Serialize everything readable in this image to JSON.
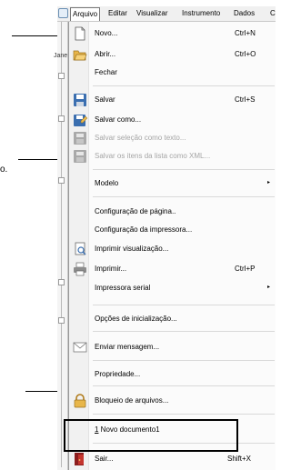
{
  "menubar": {
    "items": [
      "Arquivo",
      "Editar",
      "Visualizar",
      "Instrumento",
      "Dados",
      "C"
    ]
  },
  "background": {
    "tab_label": "Jane"
  },
  "outside_text": {
    "partial": "o."
  },
  "menu": {
    "novo": {
      "label": "Novo...",
      "shortcut": "Ctrl+N"
    },
    "abrir": {
      "label": "Abrir...",
      "shortcut": "Ctrl+O"
    },
    "fechar": {
      "label": "Fechar"
    },
    "salvar": {
      "label": "Salvar",
      "shortcut": "Ctrl+S"
    },
    "salvar_como": {
      "label": "Salvar como..."
    },
    "salvar_selecao": {
      "label": "Salvar seleção como texto..."
    },
    "salvar_itens": {
      "label": "Salvar os itens da lista como XML..."
    },
    "modelo": {
      "label": "Modelo",
      "submenu_arrow": "▸"
    },
    "config_pagina": {
      "label": "Configuração de página.."
    },
    "config_impressora": {
      "label": "Configuração da impressora..."
    },
    "imprimir_visualizacao": {
      "label": "Imprimir visualização..."
    },
    "imprimir": {
      "label": "Imprimir...",
      "shortcut": "Ctrl+P"
    },
    "impressora_serial": {
      "label": "Impressora serial",
      "submenu_arrow": "▸"
    },
    "opcoes_inicializacao": {
      "label": "Opções de inicialização..."
    },
    "enviar_mensagem": {
      "label": "Enviar mensagem..."
    },
    "propriedade": {
      "label": "Propriedade..."
    },
    "bloqueio": {
      "label": "Bloqueio de arquivos..."
    },
    "recent": {
      "number": "1",
      "label": " Novo documento1"
    },
    "sair": {
      "label": "Sair...",
      "shortcut": "Shift+X"
    }
  },
  "colors": {
    "menu_bg": "#fbfbfb",
    "gutter": "#f1f1f1",
    "disabled_text": "#a5a5a5",
    "folder_yellow": "#e8b64a",
    "floppy_blue": "#3b6fb0"
  }
}
